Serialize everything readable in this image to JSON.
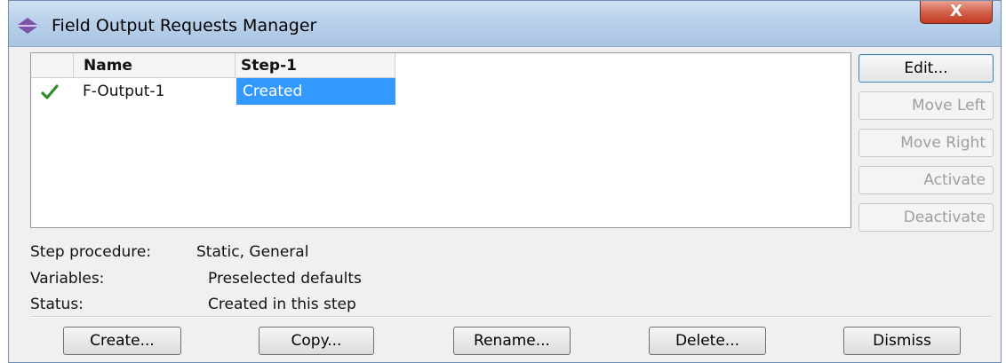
{
  "window": {
    "title": "Field Output Requests Manager",
    "close_label": "X"
  },
  "table": {
    "columns": [
      "Name",
      "Step-1"
    ],
    "rows": [
      {
        "active": true,
        "name": "F-Output-1",
        "step1": "Created"
      }
    ],
    "selected_cell_color": "#3399ff"
  },
  "side_buttons": [
    {
      "label": "Edit...",
      "enabled": true
    },
    {
      "label": "Move Left",
      "enabled": false
    },
    {
      "label": "Move Right",
      "enabled": false
    },
    {
      "label": "Activate",
      "enabled": false
    },
    {
      "label": "Deactivate",
      "enabled": false
    }
  ],
  "info": {
    "step_procedure_label": "Step procedure:",
    "step_procedure_value": "Static, General",
    "variables_label": "Variables:",
    "variables_value": "Preselected defaults",
    "status_label": "Status:",
    "status_value": "Created in this step"
  },
  "bottom_buttons": [
    "Create...",
    "Copy...",
    "Rename...",
    "Delete...",
    "Dismiss"
  ],
  "icons": {
    "title": "double-arrow-icon",
    "row_status": "checkmark-icon"
  }
}
